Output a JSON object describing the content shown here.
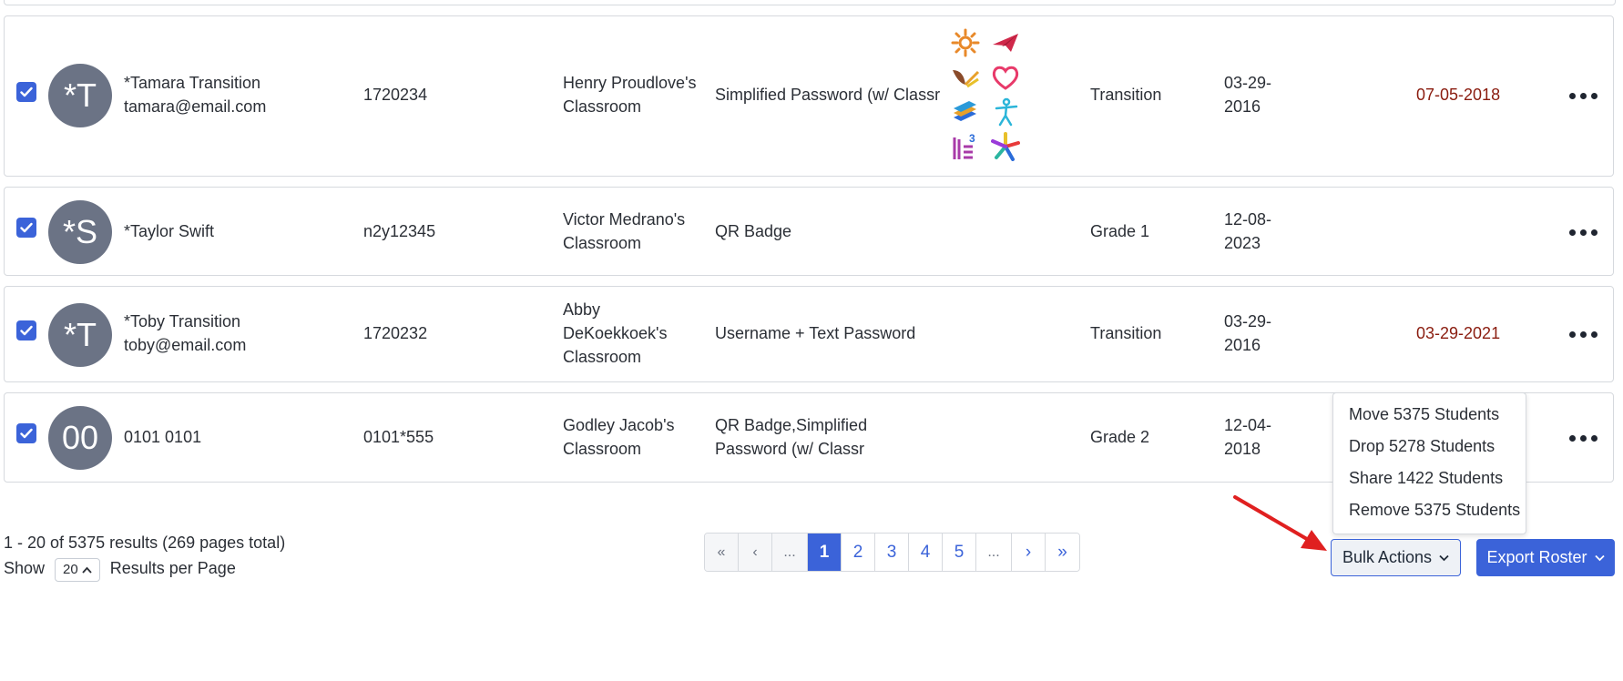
{
  "rows": [
    {
      "initials": "*T",
      "name": "*Tamara Transition",
      "email": "tamara@email.com",
      "student_id": "1720234",
      "classroom": "Henry Proudlove's Classroom",
      "login": "Simplified Password (w/ Classr",
      "grade": "Transition",
      "birthdate": "03-29-2016",
      "date": "07-05-2018",
      "apps": [
        "sun-app-icon",
        "paper-plane-app-icon",
        "leaf-app-icon",
        "heart-app-icon",
        "books-app-icon",
        "person-app-icon",
        "ll3-app-icon",
        "pinwheel-app-icon"
      ]
    },
    {
      "initials": "*S",
      "name": "*Taylor Swift",
      "email": "",
      "student_id": "n2y12345",
      "classroom": "Victor Medrano's Classroom",
      "login": "QR Badge",
      "grade": "Grade 1",
      "birthdate": "12-08-2023",
      "date": ""
    },
    {
      "initials": "*T",
      "name": "*Toby Transition",
      "email": "toby@email.com",
      "student_id": "1720232",
      "classroom": "Abby DeKoekkoek's Classroom",
      "login": "Username + Text Password",
      "grade": "Transition",
      "birthdate": "03-29-2016",
      "date": "03-29-2021"
    },
    {
      "initials": "00",
      "name": "0101 0101",
      "email": "",
      "student_id": "0101*555",
      "classroom": "Godley Jacob's Classroom",
      "login": "QR Badge,Simplified Password (w/ Classr",
      "grade": "Grade 2",
      "birthdate": "12-04-2018",
      "date": ""
    }
  ],
  "results": {
    "summary": "1 - 20 of 5375 results (269 pages total)",
    "show_label": "Show",
    "per_page_value": "20",
    "per_page_suffix": "Results per Page"
  },
  "pagination": {
    "first": "«",
    "prev": "‹",
    "ellipsis_left": "...",
    "pages": [
      "1",
      "2",
      "3",
      "4",
      "5"
    ],
    "active_page": "1",
    "ellipsis_right": "...",
    "next": "›",
    "last": "»"
  },
  "bulk_menu": {
    "items": [
      "Move 5375 Students",
      "Drop 5278 Students",
      "Share 1422 Students",
      "Remove 5375 Students"
    ]
  },
  "buttons": {
    "bulk_actions": "Bulk Actions",
    "export_roster": "Export Roster"
  },
  "colors": {
    "accent": "#3b63d9",
    "avatar": "#6b7385",
    "date_red": "#8a1c0f",
    "annotation_arrow": "#e02020"
  }
}
